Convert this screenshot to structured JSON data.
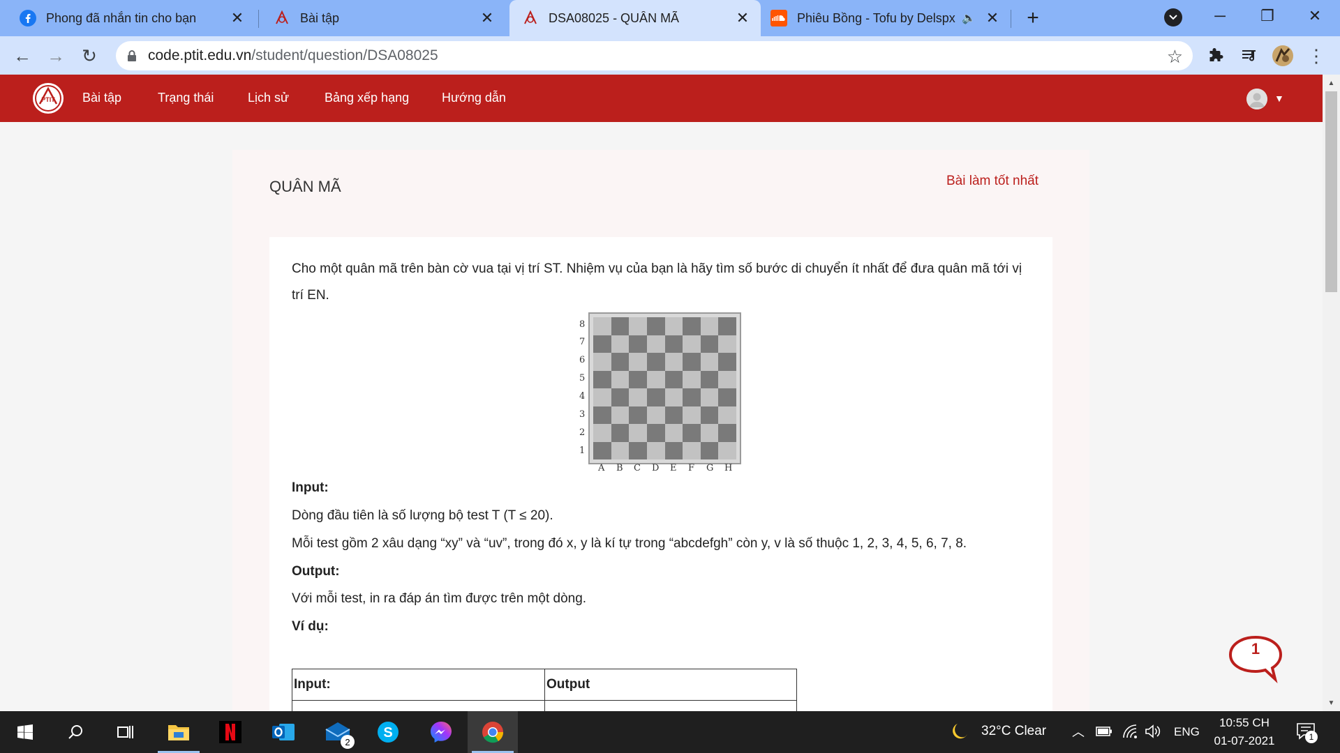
{
  "browser": {
    "tabs": [
      {
        "title": "Phong đã nhắn tin cho bạn",
        "icon": "facebook-icon",
        "active": false
      },
      {
        "title": "Bài tập",
        "icon": "ptit-icon",
        "active": false
      },
      {
        "title": "DSA08025 - QUÂN MÃ",
        "icon": "ptit-icon",
        "active": true
      },
      {
        "title": "Phiêu Bồng - Tofu by Delspx",
        "icon": "soundcloud-icon",
        "active": false,
        "audio": "speaker-icon"
      }
    ],
    "new_tab": "+",
    "url_domain": "code.ptit.edu.vn",
    "url_path": "/student/question/DSA08025"
  },
  "site": {
    "nav": [
      "Bài tập",
      "Trạng thái",
      "Lịch sử",
      "Bảng xếp hạng",
      "Hướng dẫn"
    ],
    "brand_color": "#bb1f1c"
  },
  "problem": {
    "title": "QUÂN MÃ",
    "best_link": "Bài làm tốt nhất",
    "desc_line1": "Cho một quân mã trên bàn cờ vua tại vị trí ST. Nhiệm vụ của bạn là hãy tìm số bước di chuyển ít nhất để đưa quân mã tới vị",
    "desc_line2": "trí EN.",
    "board": {
      "ranks": [
        "8",
        "7",
        "6",
        "5",
        "4",
        "3",
        "2",
        "1"
      ],
      "files": [
        "A",
        "B",
        "C",
        "D",
        "E",
        "F",
        "G",
        "H"
      ]
    },
    "input_heading": "Input:",
    "input_line1": "Dòng đầu tiên là số lượng bộ test T (T ≤ 20).",
    "input_line2": "Mỗi test gồm 2 xâu dạng “xy” và “uv”, trong đó x, y là kí tự trong “abcdefgh” còn y, v là số thuộc 1, 2, 3, 4, 5, 6, 7, 8.",
    "output_heading": "Output:",
    "output_line1": "Với mỗi test, in ra đáp án tìm được trên một dòng.",
    "example_heading": "Ví dụ:",
    "table_headers": [
      "Input:",
      "Output"
    ]
  },
  "chat": {
    "count": "1"
  },
  "taskbar": {
    "apps": [
      "windows-start-icon",
      "search-icon",
      "task-view-icon",
      "file-explorer-icon",
      "netflix-icon",
      "outlook-icon",
      "mail-icon",
      "skype-icon",
      "messenger-icon",
      "chrome-icon"
    ],
    "mail_badge": "2",
    "weather": "32°C  Clear",
    "language": "ENG",
    "time": "10:55 CH",
    "date": "01-07-2021",
    "notification_count": "1"
  }
}
